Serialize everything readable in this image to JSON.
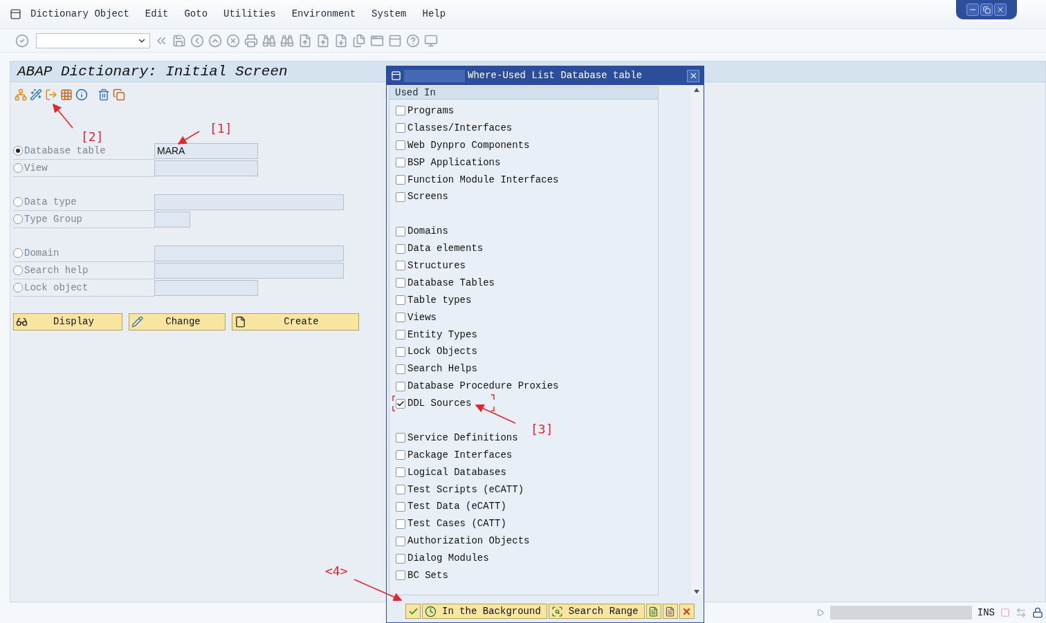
{
  "menu": [
    "Dictionary Object",
    "Edit",
    "Goto",
    "Utilities",
    "Environment",
    "System",
    "Help"
  ],
  "screen_title": "ABAP Dictionary: Initial Screen",
  "object_groups": [
    [
      {
        "label": "Database table",
        "selected": true,
        "value": "MARA"
      },
      {
        "label": "View",
        "selected": false
      }
    ],
    [
      {
        "label": "Data type",
        "selected": false
      },
      {
        "label": "Type Group",
        "selected": false
      }
    ],
    [
      {
        "label": "Domain",
        "selected": false
      },
      {
        "label": "Search help",
        "selected": false
      },
      {
        "label": "Lock object",
        "selected": false
      }
    ]
  ],
  "actions": [
    {
      "label": "Display",
      "kind": "display"
    },
    {
      "label": "Change",
      "kind": "change"
    },
    {
      "label": "Create",
      "kind": "create"
    }
  ],
  "dialog": {
    "title": "Where-Used List Database table",
    "header": "Used In",
    "groups": [
      [
        {
          "label": "Programs",
          "checked": false
        },
        {
          "label": "Classes/Interfaces",
          "checked": false
        },
        {
          "label": "Web Dynpro Components",
          "checked": false
        },
        {
          "label": "BSP Applications",
          "checked": false
        },
        {
          "label": "Function Module Interfaces",
          "checked": false
        },
        {
          "label": "Screens",
          "checked": false
        }
      ],
      [
        {
          "label": "Domains",
          "checked": false
        },
        {
          "label": "Data elements",
          "checked": false
        },
        {
          "label": "Structures",
          "checked": false
        },
        {
          "label": "Database Tables",
          "checked": false
        },
        {
          "label": "Table types",
          "checked": false
        },
        {
          "label": "Views",
          "checked": false
        },
        {
          "label": "Entity Types",
          "checked": false
        },
        {
          "label": "Lock Objects",
          "checked": false
        },
        {
          "label": "Search Helps",
          "checked": false
        },
        {
          "label": "Database Procedure Proxies",
          "checked": false
        },
        {
          "label": "DDL Sources",
          "checked": true
        }
      ],
      [
        {
          "label": "Service Definitions",
          "checked": false
        },
        {
          "label": "Package Interfaces",
          "checked": false
        },
        {
          "label": "Logical Databases",
          "checked": false
        },
        {
          "label": "Test Scripts (eCATT)",
          "checked": false
        },
        {
          "label": "Test Data (eCATT)",
          "checked": false
        },
        {
          "label": "Test Cases (CATT)",
          "checked": false
        },
        {
          "label": "Authorization Objects",
          "checked": false
        },
        {
          "label": "Dialog Modules",
          "checked": false
        },
        {
          "label": "BC Sets",
          "checked": false
        }
      ]
    ],
    "buttons": [
      {
        "label": "In the Background",
        "kind": "background"
      },
      {
        "label": "Search Range",
        "kind": "range"
      }
    ]
  },
  "status_bar": {
    "mode": "INS"
  },
  "annotations": [
    {
      "label": "[1]"
    },
    {
      "label": "[2]"
    },
    {
      "label": "[3]"
    },
    {
      "label": "<4>"
    }
  ]
}
